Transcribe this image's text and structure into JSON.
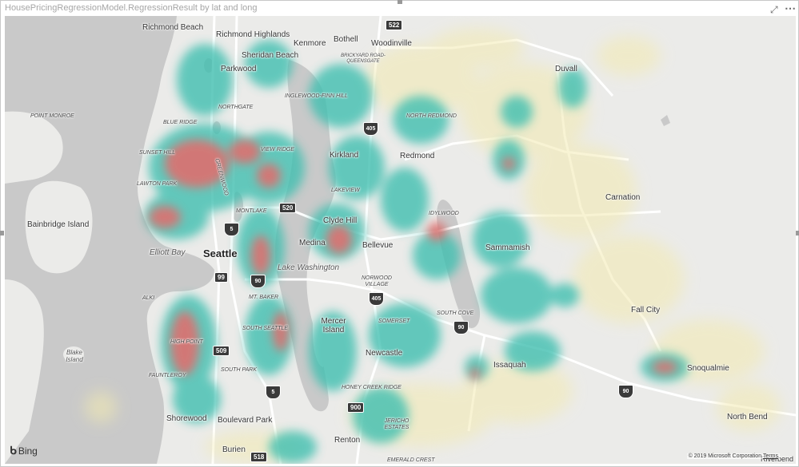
{
  "visual": {
    "title": "HousePricingRegressionModel.RegressionResult by lat and long",
    "focus_icon": "focus-mode-icon",
    "more_icon": "more-options-icon"
  },
  "map": {
    "provider": "Bing",
    "copyright": "© 2019 Microsoft Corporation",
    "terms": "Terms",
    "water_color": "#c9c9c9",
    "land_color": "#ebebe9",
    "heat_colors": {
      "low": "#f3eab0",
      "mid": "#3fbfb0",
      "high": "#e56b6b"
    },
    "cities": [
      {
        "name": "Richmond Beach"
      },
      {
        "name": "Richmond Highlands"
      },
      {
        "name": "Kenmore"
      },
      {
        "name": "Bothell"
      },
      {
        "name": "Woodinville"
      },
      {
        "name": "Sheridan Beach"
      },
      {
        "name": "Parkwood"
      },
      {
        "name": "Duvall"
      },
      {
        "name": "Kirkland"
      },
      {
        "name": "Redmond"
      },
      {
        "name": "Carnation"
      },
      {
        "name": "Bainbridge Island"
      },
      {
        "name": "Elliott Bay"
      },
      {
        "name": "Seattle"
      },
      {
        "name": "Medina"
      },
      {
        "name": "Clyde Hill"
      },
      {
        "name": "Bellevue"
      },
      {
        "name": "Lake Washington"
      },
      {
        "name": "Sammamish"
      },
      {
        "name": "Fall City"
      },
      {
        "name": "Mercer Island"
      },
      {
        "name": "Newcastle"
      },
      {
        "name": "Issaquah"
      },
      {
        "name": "Snoqualmie"
      },
      {
        "name": "Blake Island"
      },
      {
        "name": "Shorewood"
      },
      {
        "name": "Boulevard Park"
      },
      {
        "name": "Renton"
      },
      {
        "name": "Burien"
      },
      {
        "name": "North Bend"
      },
      {
        "name": "Riverbend"
      }
    ],
    "neighborhoods": [
      {
        "name": "BRICKYARD ROAD-QUEENSGATE"
      },
      {
        "name": "INGLEWOOD-FINN HILL"
      },
      {
        "name": "NORTH REDMOND"
      },
      {
        "name": "POINT MONROE"
      },
      {
        "name": "NORTHGATE"
      },
      {
        "name": "BLUE RIDGE"
      },
      {
        "name": "SUNSET HILL"
      },
      {
        "name": "GREENWOOD"
      },
      {
        "name": "VIEW RIDGE"
      },
      {
        "name": "LAWTON PARK"
      },
      {
        "name": "LAKEVIEW"
      },
      {
        "name": "MONTLAKE"
      },
      {
        "name": "IDYLWOOD"
      },
      {
        "name": "NORWOOD VILLAGE"
      },
      {
        "name": "ALKI"
      },
      {
        "name": "MT. BAKER"
      },
      {
        "name": "SOUTH COVE"
      },
      {
        "name": "SOMERSET"
      },
      {
        "name": "SOUTH SEATTLE"
      },
      {
        "name": "HIGH POINT"
      },
      {
        "name": "SOUTH PARK"
      },
      {
        "name": "FAUNTLEROY"
      },
      {
        "name": "HONEY CREEK RIDGE"
      },
      {
        "name": "JERICHO ESTATES"
      },
      {
        "name": "EMERALD CREST"
      }
    ],
    "shields": [
      {
        "route": "522",
        "kind": "state"
      },
      {
        "route": "405",
        "kind": "interstate"
      },
      {
        "route": "520",
        "kind": "state"
      },
      {
        "route": "5",
        "kind": "interstate"
      },
      {
        "route": "99",
        "kind": "state"
      },
      {
        "route": "90",
        "kind": "interstate"
      },
      {
        "route": "405",
        "kind": "interstate"
      },
      {
        "route": "90",
        "kind": "interstate"
      },
      {
        "route": "509",
        "kind": "state"
      },
      {
        "route": "5",
        "kind": "interstate"
      },
      {
        "route": "900",
        "kind": "state"
      },
      {
        "route": "90",
        "kind": "interstate"
      },
      {
        "route": "518",
        "kind": "state"
      }
    ]
  }
}
